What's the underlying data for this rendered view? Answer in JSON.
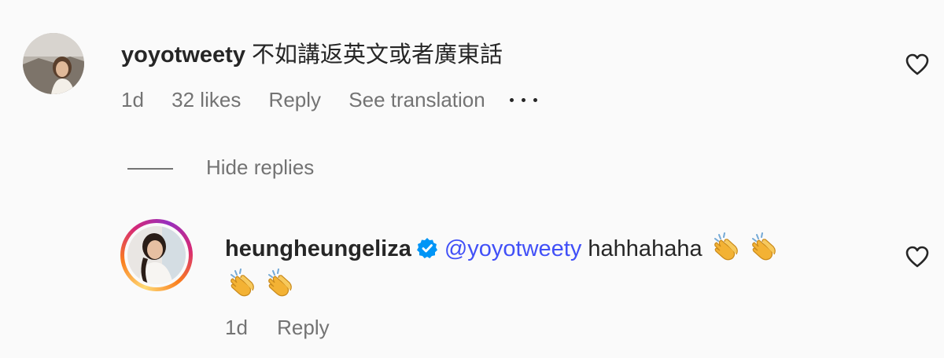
{
  "comment": {
    "username": "yoyotweety",
    "text": "不如講返英文或者廣東話",
    "time": "1d",
    "likes": "32 likes",
    "reply_label": "Reply",
    "translate_label": "See translation",
    "avatar_icon": "user-photo-avatar",
    "more_icon": "more-horizontal-icon",
    "like_icon": "heart-outline-icon"
  },
  "hide_replies_label": "Hide replies",
  "reply": {
    "username": "heungheungeliza",
    "verified_icon": "verified-badge-icon",
    "mention": "@yoyotweety",
    "text": "hahhahaha",
    "emoji_icon": "clapping-hands-icon",
    "emoji_count": 4,
    "time": "1d",
    "reply_label": "Reply",
    "avatar_icon": "story-ring-avatar",
    "like_icon": "heart-outline-icon"
  },
  "colors": {
    "mention": "#4150f7",
    "verified": "#0095f6",
    "secondary_text": "#737373",
    "background": "#fafafa"
  }
}
